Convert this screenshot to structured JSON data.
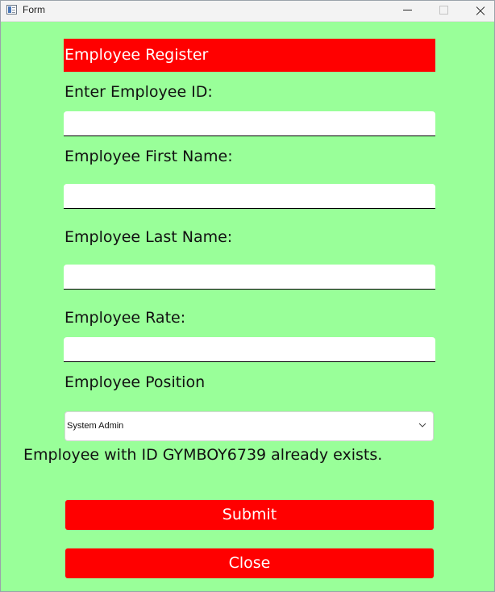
{
  "window": {
    "title": "Form"
  },
  "header": {
    "title": "Employee Register"
  },
  "form": {
    "employee_id": {
      "label": "Enter Employee ID:",
      "value": ""
    },
    "first_name": {
      "label": "Employee First Name:",
      "value": ""
    },
    "last_name": {
      "label": "Employee Last Name:",
      "value": ""
    },
    "rate": {
      "label": "Employee Rate:",
      "value": ""
    },
    "position": {
      "label": "Employee Position",
      "selected": "System Admin"
    }
  },
  "status": {
    "message": "Employee with ID GYMBOY6739 already exists."
  },
  "buttons": {
    "submit": "Submit",
    "close": "Close"
  },
  "colors": {
    "background": "#99ff99",
    "accent": "#ff0000"
  }
}
